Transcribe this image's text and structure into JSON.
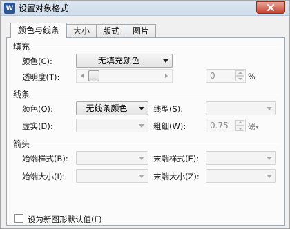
{
  "window": {
    "title": "设置对象格式"
  },
  "tabs": [
    {
      "label": "颜色与线条",
      "active": true
    },
    {
      "label": "大小",
      "active": false
    },
    {
      "label": "版式",
      "active": false
    },
    {
      "label": "图片",
      "active": false
    }
  ],
  "fill": {
    "section": "填充",
    "color_label": "颜色(C):",
    "color_value": "无填充颜色",
    "transparency_label": "透明度(T):",
    "transparency_value": "0",
    "transparency_unit": "%",
    "transparency_level": 0
  },
  "line": {
    "section": "线条",
    "color_label": "颜色(O):",
    "color_value": "无线条颜色",
    "style_label": "线型(S):",
    "style_value": "",
    "dash_label": "虚实(D):",
    "dash_value": "",
    "weight_label": "粗细(W):",
    "weight_value": "0.75",
    "weight_unit": "磅"
  },
  "arrows": {
    "section": "箭头",
    "begin_style_label": "始端样式(B):",
    "begin_style_value": "",
    "end_style_label": "末端样式(E):",
    "end_style_value": "",
    "begin_size_label": "始端大小(I):",
    "begin_size_value": "",
    "end_size_label": "末端大小(Z):",
    "end_size_value": ""
  },
  "footer": {
    "default_checkbox_label": "设为新图形默认值(F)",
    "default_checked": false
  },
  "icons": {
    "app": "wps-writer-icon",
    "close": "close-icon"
  },
  "colors": {
    "titlebar": "#d6e1ee",
    "close": "#c7432f",
    "panel": "#fbfbfb"
  }
}
